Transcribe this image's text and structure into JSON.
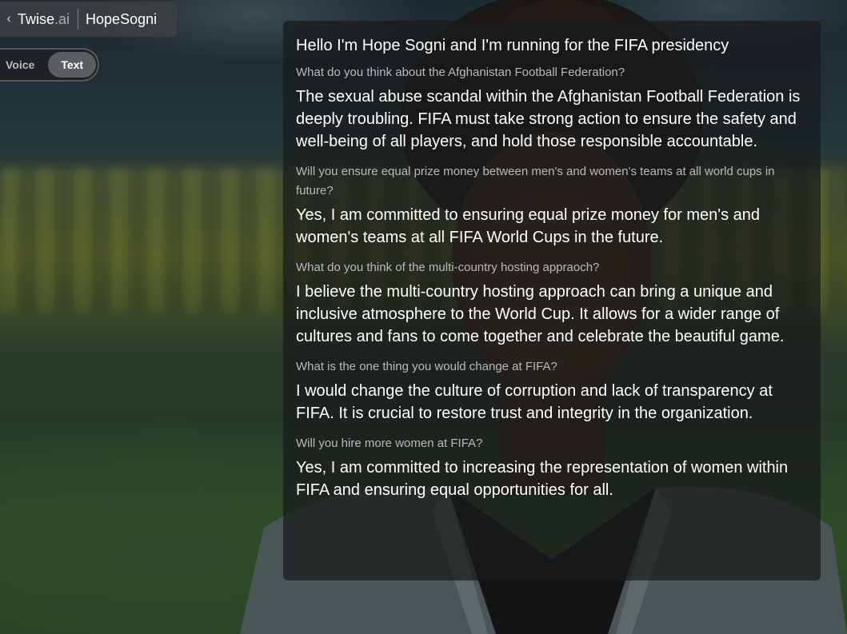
{
  "header": {
    "back_icon": "chevron-left-icon",
    "brand_main": "Twise",
    "brand_suffix": ".ai",
    "agent_name": "HopeSogni"
  },
  "mode_toggle": {
    "options": [
      "Voice",
      "Text"
    ],
    "selected": "Text"
  },
  "chat": {
    "intro": "Hello I'm Hope Sogni and I'm running for the FIFA presidency",
    "messages": [
      {
        "question": "What do you think about the Afghanistan Football Federation?",
        "answer": "The sexual abuse scandal within the Afghanistan Football Federation is deeply troubling. FIFA must take strong action to ensure the safety and well-being of all players, and hold those responsible accountable."
      },
      {
        "question": "Will you ensure equal prize money between men's and women's teams at all world cups in future?",
        "answer": "Yes, I am committed to ensuring equal prize money for men's and women's teams at all FIFA World Cups in the future."
      },
      {
        "question": "What do you think of the multi-country hosting appraoch?",
        "answer": "I believe the multi-country hosting approach can bring a unique and inclusive atmosphere to the World Cup. It allows for a wider range of cultures and fans to come together and celebrate the beautiful game."
      },
      {
        "question": "What is the one thing you would change at FIFA?",
        "answer": "I would change the culture of corruption and lack of transparency at FIFA. It is crucial to restore trust and integrity in the organization."
      },
      {
        "question": "Will you hire more women at FIFA?",
        "answer": "Yes, I am committed to increasing the representation of women within FIFA and ensuring equal opportunities for all."
      }
    ]
  },
  "colors": {
    "panel_bg": "#181a1b",
    "question_text": "#b7babc",
    "answer_text": "#ffffff",
    "toggle_active": "#5a5e60"
  }
}
